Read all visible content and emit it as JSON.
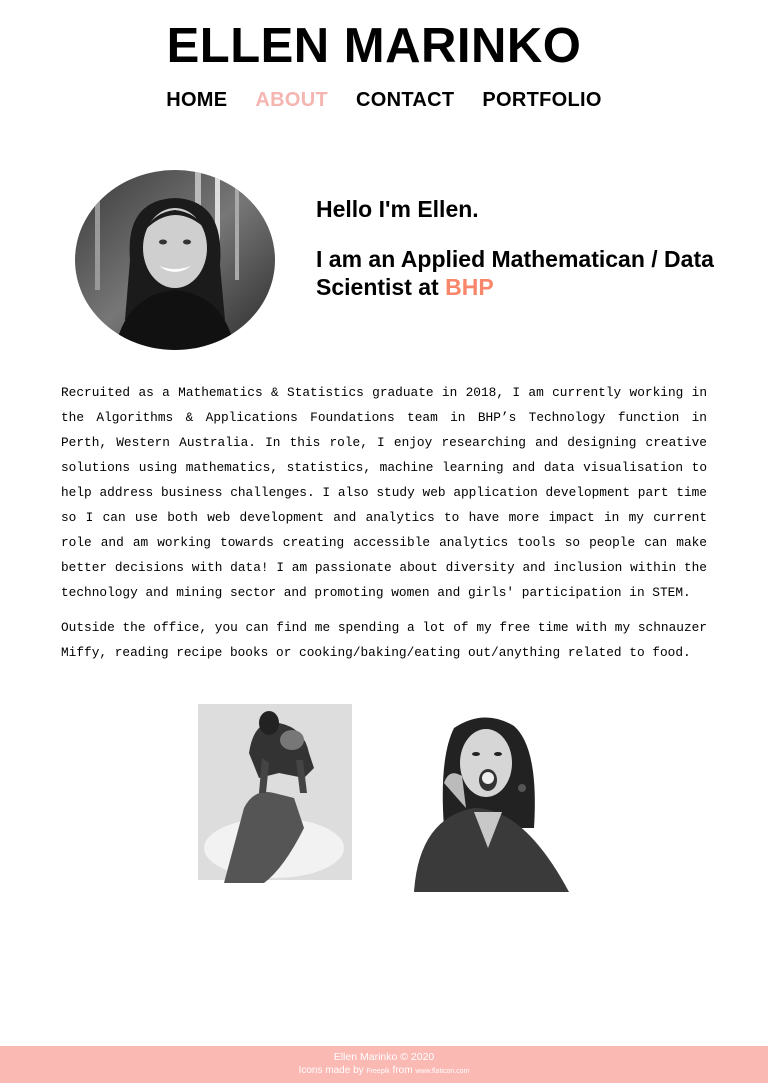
{
  "header": {
    "site_title": "ELLEN MARINKO",
    "nav": [
      {
        "label": "HOME",
        "active": false
      },
      {
        "label": "ABOUT",
        "active": true
      },
      {
        "label": "CONTACT",
        "active": false
      },
      {
        "label": "PORTFOLIO",
        "active": false
      }
    ]
  },
  "intro": {
    "hello": "Hello I'm Ellen.",
    "role_text": "I am an Applied Mathematican / Data Scientist at",
    "company": "BHP"
  },
  "bio": {
    "paragraph1": "Recruited as a Mathematics & Statistics graduate in 2018, I am currently working in the Algorithms & Applications Foundations team in BHP’s Technology function in Perth, Western Australia. In this role, I enjoy researching and designing creative solutions using mathematics, statistics, machine learning and data visualisation to help address business challenges. I also study web application development part time so I can use both web development and analytics to have more impact in my current role and am working towards creating accessible analytics tools so people can make better decisions with data! I am passionate about diversity and inclusion within the technology and mining sector and promoting women and girls' participation in STEM.",
    "paragraph2": "Outside the office, you can find me spending a lot of my free time with my schnauzer Miffy, reading recipe books or cooking/baking/eating out/anything related to food."
  },
  "footer": {
    "copyright": "Ellen Marinko © 2020",
    "credits_prefix": "Icons made by",
    "credits_author": "Freepik",
    "credits_from": "from",
    "credits_site": "www.flaticon.com"
  },
  "colors": {
    "accent_pink": "#f5b5b0",
    "accent_orange": "#f7866a",
    "footer_bg": "#fbb9b4"
  }
}
